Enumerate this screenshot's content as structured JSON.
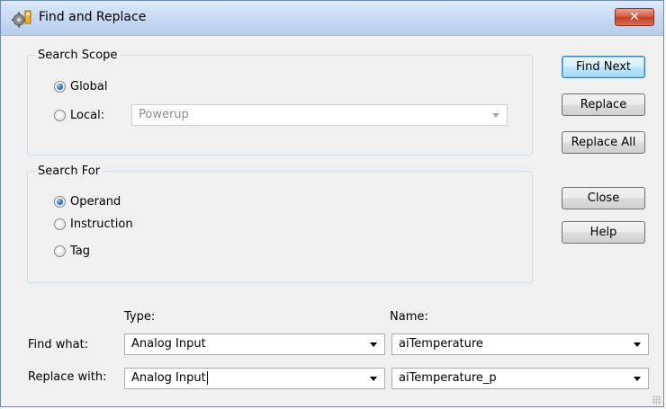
{
  "window": {
    "title": "Find and Replace",
    "close_glyph": "✕",
    "icon": "gears-app-icon"
  },
  "search_scope": {
    "legend": "Search Scope",
    "options": [
      {
        "label": "Global",
        "checked": true
      },
      {
        "label": "Local:",
        "checked": false
      }
    ],
    "local_value": "Powerup",
    "local_enabled": false
  },
  "search_for": {
    "legend": "Search For",
    "options": [
      {
        "label": "Operand",
        "checked": true
      },
      {
        "label": "Instruction",
        "checked": false
      },
      {
        "label": "Tag",
        "checked": false
      }
    ]
  },
  "fields": {
    "type_header": "Type:",
    "name_header": "Name:",
    "find_what_label": "Find what:",
    "replace_with_label": "Replace with:",
    "find_type": "Analog Input",
    "find_name": "aiTemperature",
    "replace_type": "Analog Input",
    "replace_name": "aiTemperature_p"
  },
  "buttons": {
    "find_next": "Find Next",
    "replace": "Replace",
    "replace_all": "Replace All",
    "close": "Close",
    "help": "Help"
  },
  "colors": {
    "title_bar": "#c9dbf4",
    "close_button": "#c23d22",
    "default_button": "#bee6fd",
    "radio_selected": "#2a6fc4"
  }
}
